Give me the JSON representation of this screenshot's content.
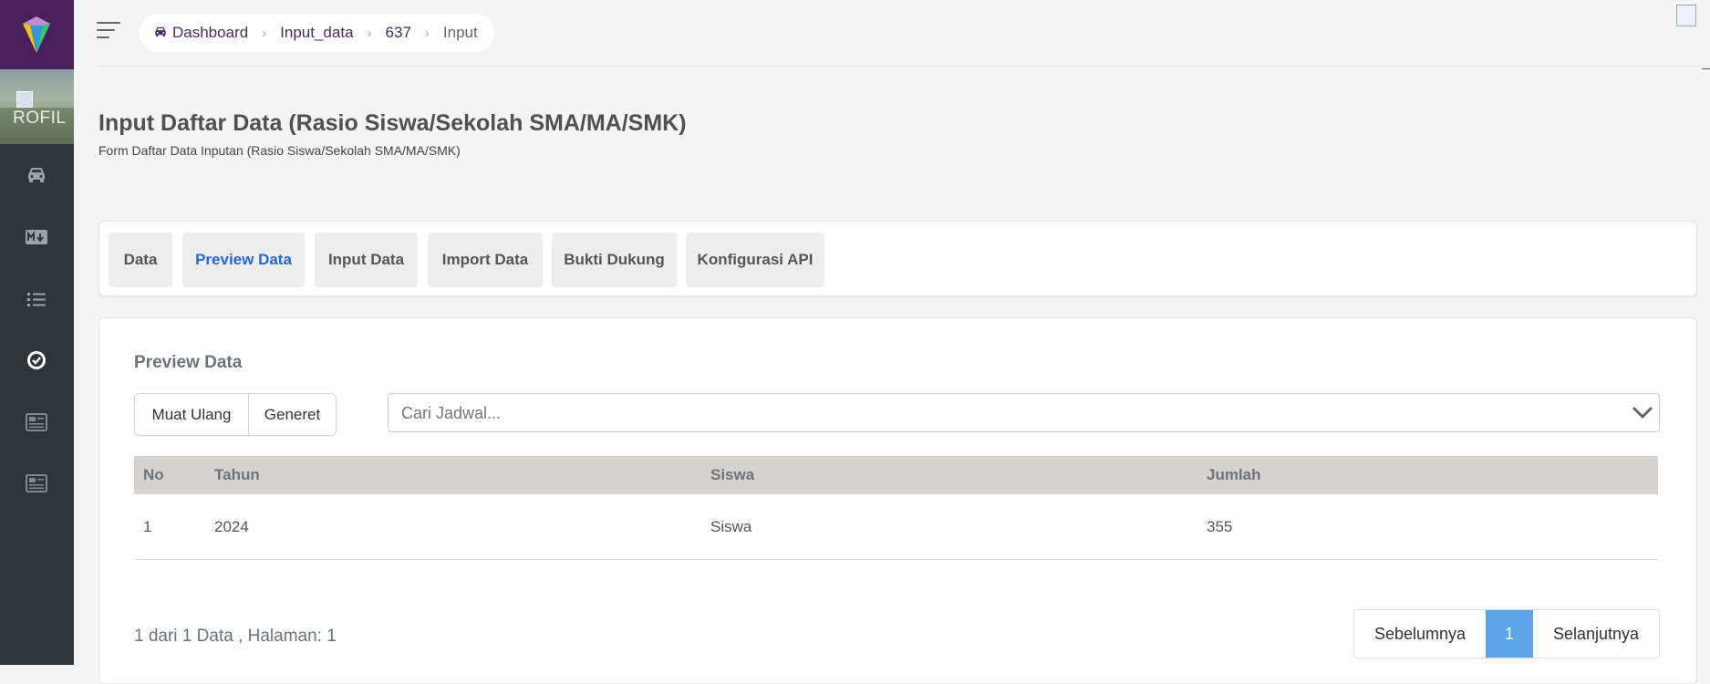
{
  "sidebar": {
    "logo_icon": "gem-logo",
    "profile_alt": "ROFIL",
    "items": [
      {
        "name": "sidebar-item-dashboard",
        "icon": "car-icon"
      },
      {
        "name": "sidebar-item-markdown",
        "icon": "markdown-icon"
      },
      {
        "name": "sidebar-item-list",
        "icon": "list-icon"
      },
      {
        "name": "sidebar-item-check",
        "icon": "check-circle-icon"
      },
      {
        "name": "sidebar-item-document-1",
        "icon": "document-icon"
      },
      {
        "name": "sidebar-item-document-2",
        "icon": "document-icon"
      }
    ]
  },
  "breadcrumb": {
    "items": [
      "Dashboard",
      "Input_data",
      "637",
      "Input"
    ]
  },
  "page": {
    "title": "Input Daftar Data (Rasio Siswa/Sekolah SMA/MA/SMK)",
    "subtitle": "Form Daftar Data Inputan (Rasio Siswa/Sekolah SMA/MA/SMK)"
  },
  "tabs": [
    {
      "label": "Data",
      "active": false
    },
    {
      "label": "Preview Data",
      "active": true
    },
    {
      "label": "Input Data",
      "active": false
    },
    {
      "label": "Import Data",
      "active": false
    },
    {
      "label": "Bukti Dukung",
      "active": false
    },
    {
      "label": "Konfigurasi API",
      "active": false
    }
  ],
  "preview": {
    "section_title": "Preview Data",
    "buttons": {
      "reload": "Muat Ulang",
      "generate": "Generet"
    },
    "search_placeholder": "Cari Jadwal...",
    "table": {
      "headers": [
        "No",
        "Tahun",
        "Siswa",
        "Jumlah"
      ],
      "rows": [
        [
          "1",
          "2024",
          "Siswa",
          "355"
        ]
      ]
    },
    "page_info": "1 dari 1 Data , Halaman: 1",
    "pager": {
      "prev": "Sebelumnya",
      "current": "1",
      "next": "Selanjutnya"
    }
  },
  "colors": {
    "sidebar_bg": "#2f3538",
    "logo_bg": "#4a1f5c",
    "accent_blue": "#2467d6",
    "pager_active": "#5aa5e6",
    "table_header_bg": "#d6d2cf"
  }
}
